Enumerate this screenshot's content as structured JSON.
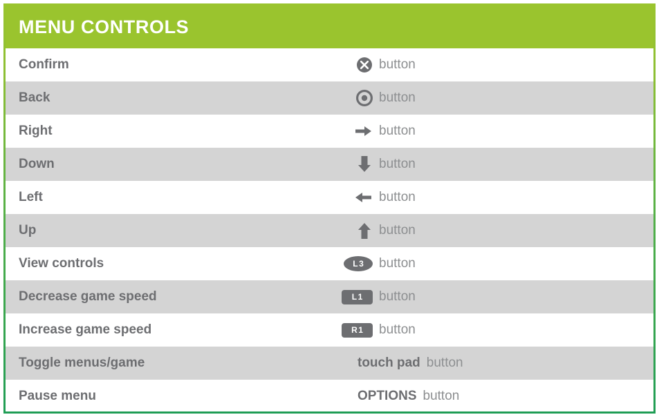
{
  "panel": {
    "header_title": "MENU CONTROLS",
    "button_word": "button",
    "colors": {
      "header_green": "#9ac42e",
      "border_bottom_green": "#1f9d55",
      "row_stripe_gray": "#d4d4d4",
      "row_stripe_white": "#ffffff",
      "action_text_gray": "#6d6e71",
      "button_word_gray": "#8d8f91",
      "header_text_white": "#ffffff"
    },
    "rows": [
      {
        "action": "Confirm",
        "icon": "cross-button-icon",
        "icon_label": "",
        "binding_suffix": "button"
      },
      {
        "action": "Back",
        "icon": "circle-button-icon",
        "icon_label": "",
        "binding_suffix": "button"
      },
      {
        "action": "Right",
        "icon": "arrow-right-icon",
        "icon_label": "",
        "binding_suffix": "button"
      },
      {
        "action": "Down",
        "icon": "arrow-down-icon",
        "icon_label": "",
        "binding_suffix": "button"
      },
      {
        "action": "Left",
        "icon": "arrow-left-icon",
        "icon_label": "",
        "binding_suffix": "button"
      },
      {
        "action": "Up",
        "icon": "arrow-up-icon",
        "icon_label": "",
        "binding_suffix": "button"
      },
      {
        "action": "View controls",
        "icon": "l3-badge-icon",
        "icon_label": "L3",
        "binding_suffix": "button"
      },
      {
        "action": "Decrease game speed",
        "icon": "l1-badge-icon",
        "icon_label": "L1",
        "binding_suffix": "button"
      },
      {
        "action": "Increase game speed",
        "icon": "r1-badge-icon",
        "icon_label": "R1",
        "binding_suffix": "button"
      },
      {
        "action": "Toggle menus/game",
        "icon": "touch-pad-text",
        "icon_label": "touch pad",
        "binding_suffix": "button"
      },
      {
        "action": "Pause menu",
        "icon": "options-text",
        "icon_label": "OPTIONS",
        "binding_suffix": "button"
      }
    ]
  }
}
